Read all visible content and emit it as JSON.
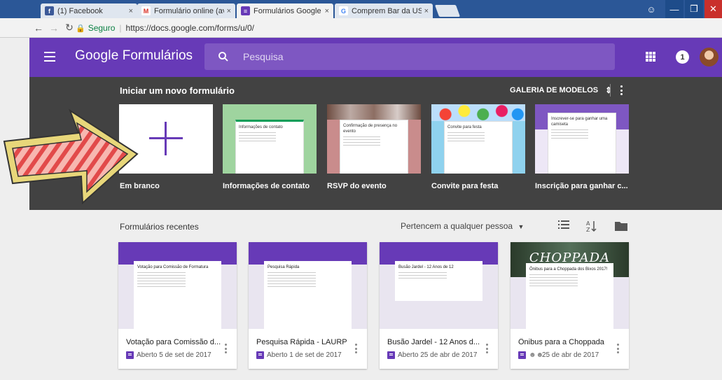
{
  "browser": {
    "tabs": [
      {
        "title": "(1) Facebook",
        "icon": "facebook-icon",
        "color": "#3b5998",
        "active": false
      },
      {
        "title": "Formulário online (avalia",
        "icon": "gmail-icon",
        "color": "#d93025",
        "active": false
      },
      {
        "title": "Formulários Google",
        "icon": "forms-icon",
        "color": "#673ab7",
        "active": true
      },
      {
        "title": "Comprem Bar da USP - F",
        "icon": "google-icon",
        "color": "#4285f4",
        "active": false
      }
    ],
    "close_glyph": "×",
    "secure_label": "Seguro",
    "url": "https://docs.google.com/forms/u/0/"
  },
  "header": {
    "brand_google": "Google",
    "brand_product": "Formulários",
    "search_placeholder": "Pesquisa",
    "notification_count": "1",
    "accent": "#673ab7"
  },
  "templates": {
    "heading": "Iniciar um novo formulário",
    "gallery_label": "GALERIA DE MODELOS",
    "items": [
      {
        "label": "Em branco",
        "icon": "plus-icon"
      },
      {
        "label": "Informações de contato",
        "sheet_title": "Informações de contato",
        "color": "#9fd49f"
      },
      {
        "label": "RSVP do evento",
        "sheet_title": "Confirmação de presença no evento",
        "color": "#c98c8c"
      },
      {
        "label": "Convite para festa",
        "sheet_title": "Convite para festa",
        "color": "#8fd2ee"
      },
      {
        "label": "Inscrição para ganhar c...",
        "sheet_title": "Inscrever-se para ganhar uma camiseta",
        "color": "#7e57c2"
      }
    ]
  },
  "recent": {
    "heading": "Formulários recentes",
    "owner_filter": "Pertencem a qualquer pessoa",
    "forms": [
      {
        "title": "Votação para Comissão d...",
        "sheet_title": "Votação para Comissão de Formatura",
        "meta": "Aberto 5 de set de 2017",
        "shared": false
      },
      {
        "title": "Pesquisa Rápida - LAURP",
        "sheet_title": "Pesquisa Rápida",
        "meta": "Aberto 1 de set de 2017",
        "shared": false
      },
      {
        "title": "Busão Jardel - 12 Anos d...",
        "sheet_title": "Busão Jardel - 12 Anos de 12",
        "meta": "Aberto 25 de abr de 2017",
        "shared": false
      },
      {
        "title": "Ônibus para a Choppada",
        "sheet_title": "Ônibus para a Choppada dos Bixos 2017!",
        "banner": "CHOPPADA",
        "meta": "25 de abr de 2017",
        "shared": true
      }
    ]
  }
}
